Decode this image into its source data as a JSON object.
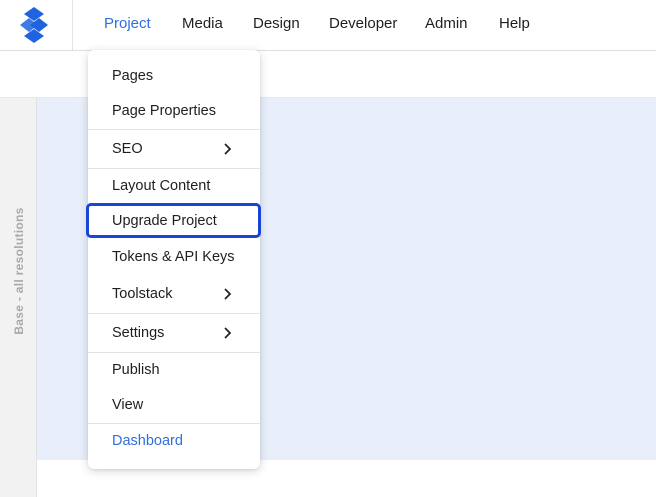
{
  "topbar": {
    "logo": "logo-icon",
    "nav": [
      "Project",
      "Media",
      "Design",
      "Developer",
      "Admin",
      "Help"
    ],
    "active_nav": "Project",
    "accent_color": "#2f6fde"
  },
  "leftpanel": {
    "label": "Base - all resolutions"
  },
  "menu": {
    "items": [
      {
        "label": "Pages"
      },
      {
        "label": "Page Properties"
      },
      {
        "label": "SEO",
        "submenu": true
      },
      {
        "label": "Layout Content"
      },
      {
        "label": "Upgrade Project",
        "highlighted": true
      },
      {
        "label": "Tokens & API Keys"
      },
      {
        "label": "Toolstack",
        "submenu": true
      },
      {
        "label": "Settings",
        "submenu": true
      },
      {
        "label": "Publish"
      },
      {
        "label": "View"
      },
      {
        "label": "Dashboard",
        "color": "#2f6fde"
      }
    ],
    "highlight_color": "#1746d6",
    "submenu_icon": "chevron-right-icon"
  },
  "canvas": {
    "background": "#e8effb"
  }
}
